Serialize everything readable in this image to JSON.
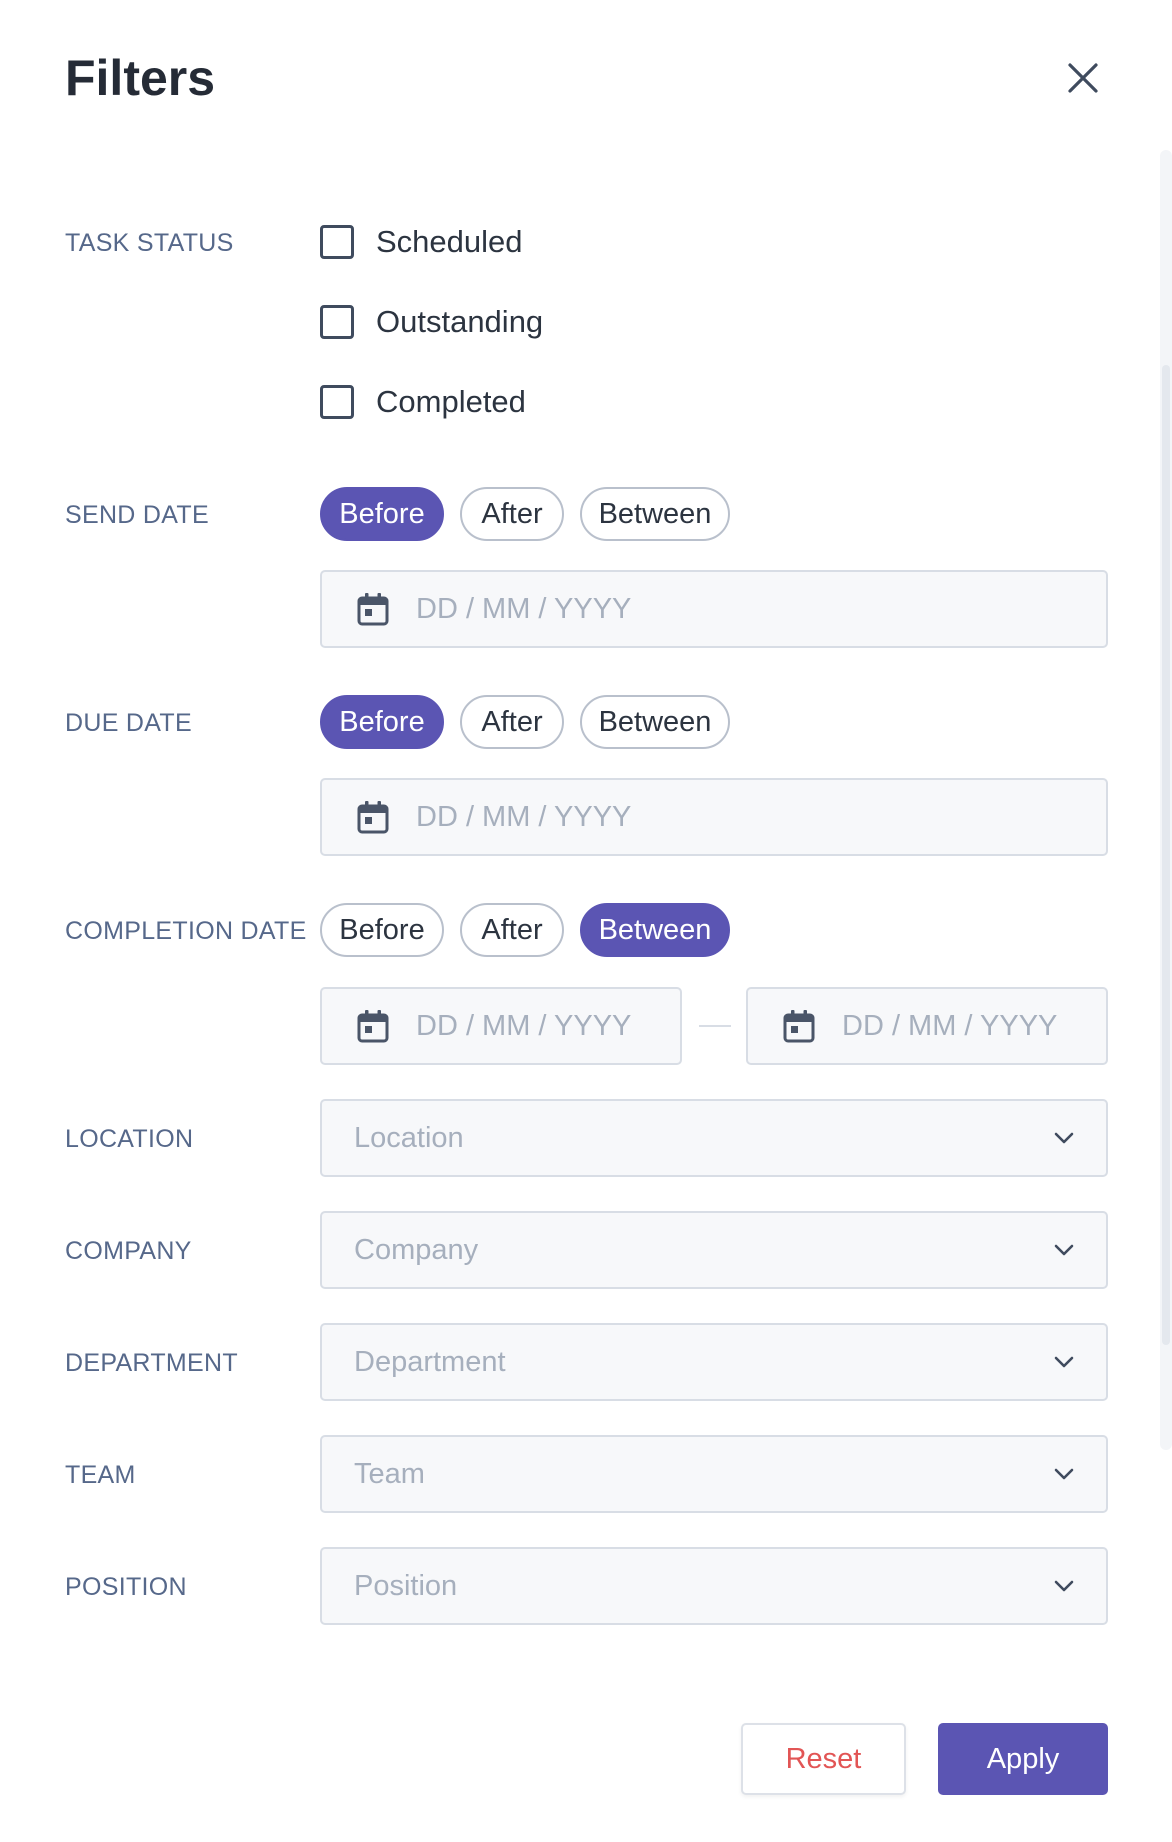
{
  "header": {
    "title": "Filters",
    "close_icon": "close-icon"
  },
  "task_status": {
    "label": "TASK STATUS",
    "options": [
      {
        "label": "Scheduled",
        "checked": false
      },
      {
        "label": "Outstanding",
        "checked": false
      },
      {
        "label": "Completed",
        "checked": false
      }
    ]
  },
  "send_date": {
    "label": "SEND DATE",
    "modes": [
      "Before",
      "After",
      "Between"
    ],
    "selected": "Before",
    "placeholder": "DD / MM / YYYY"
  },
  "due_date": {
    "label": "DUE DATE",
    "modes": [
      "Before",
      "After",
      "Between"
    ],
    "selected": "Before",
    "placeholder": "DD / MM / YYYY"
  },
  "completion_date": {
    "label": "COMPLETION DATE",
    "modes": [
      "Before",
      "After",
      "Between"
    ],
    "selected": "Between",
    "start_placeholder": "DD / MM / YYYY",
    "end_placeholder": "DD / MM / YYYY"
  },
  "location": {
    "label": "LOCATION",
    "placeholder": "Location"
  },
  "company": {
    "label": "COMPANY",
    "placeholder": "Company"
  },
  "department": {
    "label": "DEPARTMENT",
    "placeholder": "Department"
  },
  "team": {
    "label": "TEAM",
    "placeholder": "Team"
  },
  "position": {
    "label": "POSITION",
    "placeholder": "Position"
  },
  "footer": {
    "reset_label": "Reset",
    "apply_label": "Apply"
  },
  "colors": {
    "accent": "#5b55b3",
    "label": "#56688a",
    "reset_text": "#e25555",
    "input_bg": "#f7f8fa",
    "placeholder": "#a6afbd"
  }
}
